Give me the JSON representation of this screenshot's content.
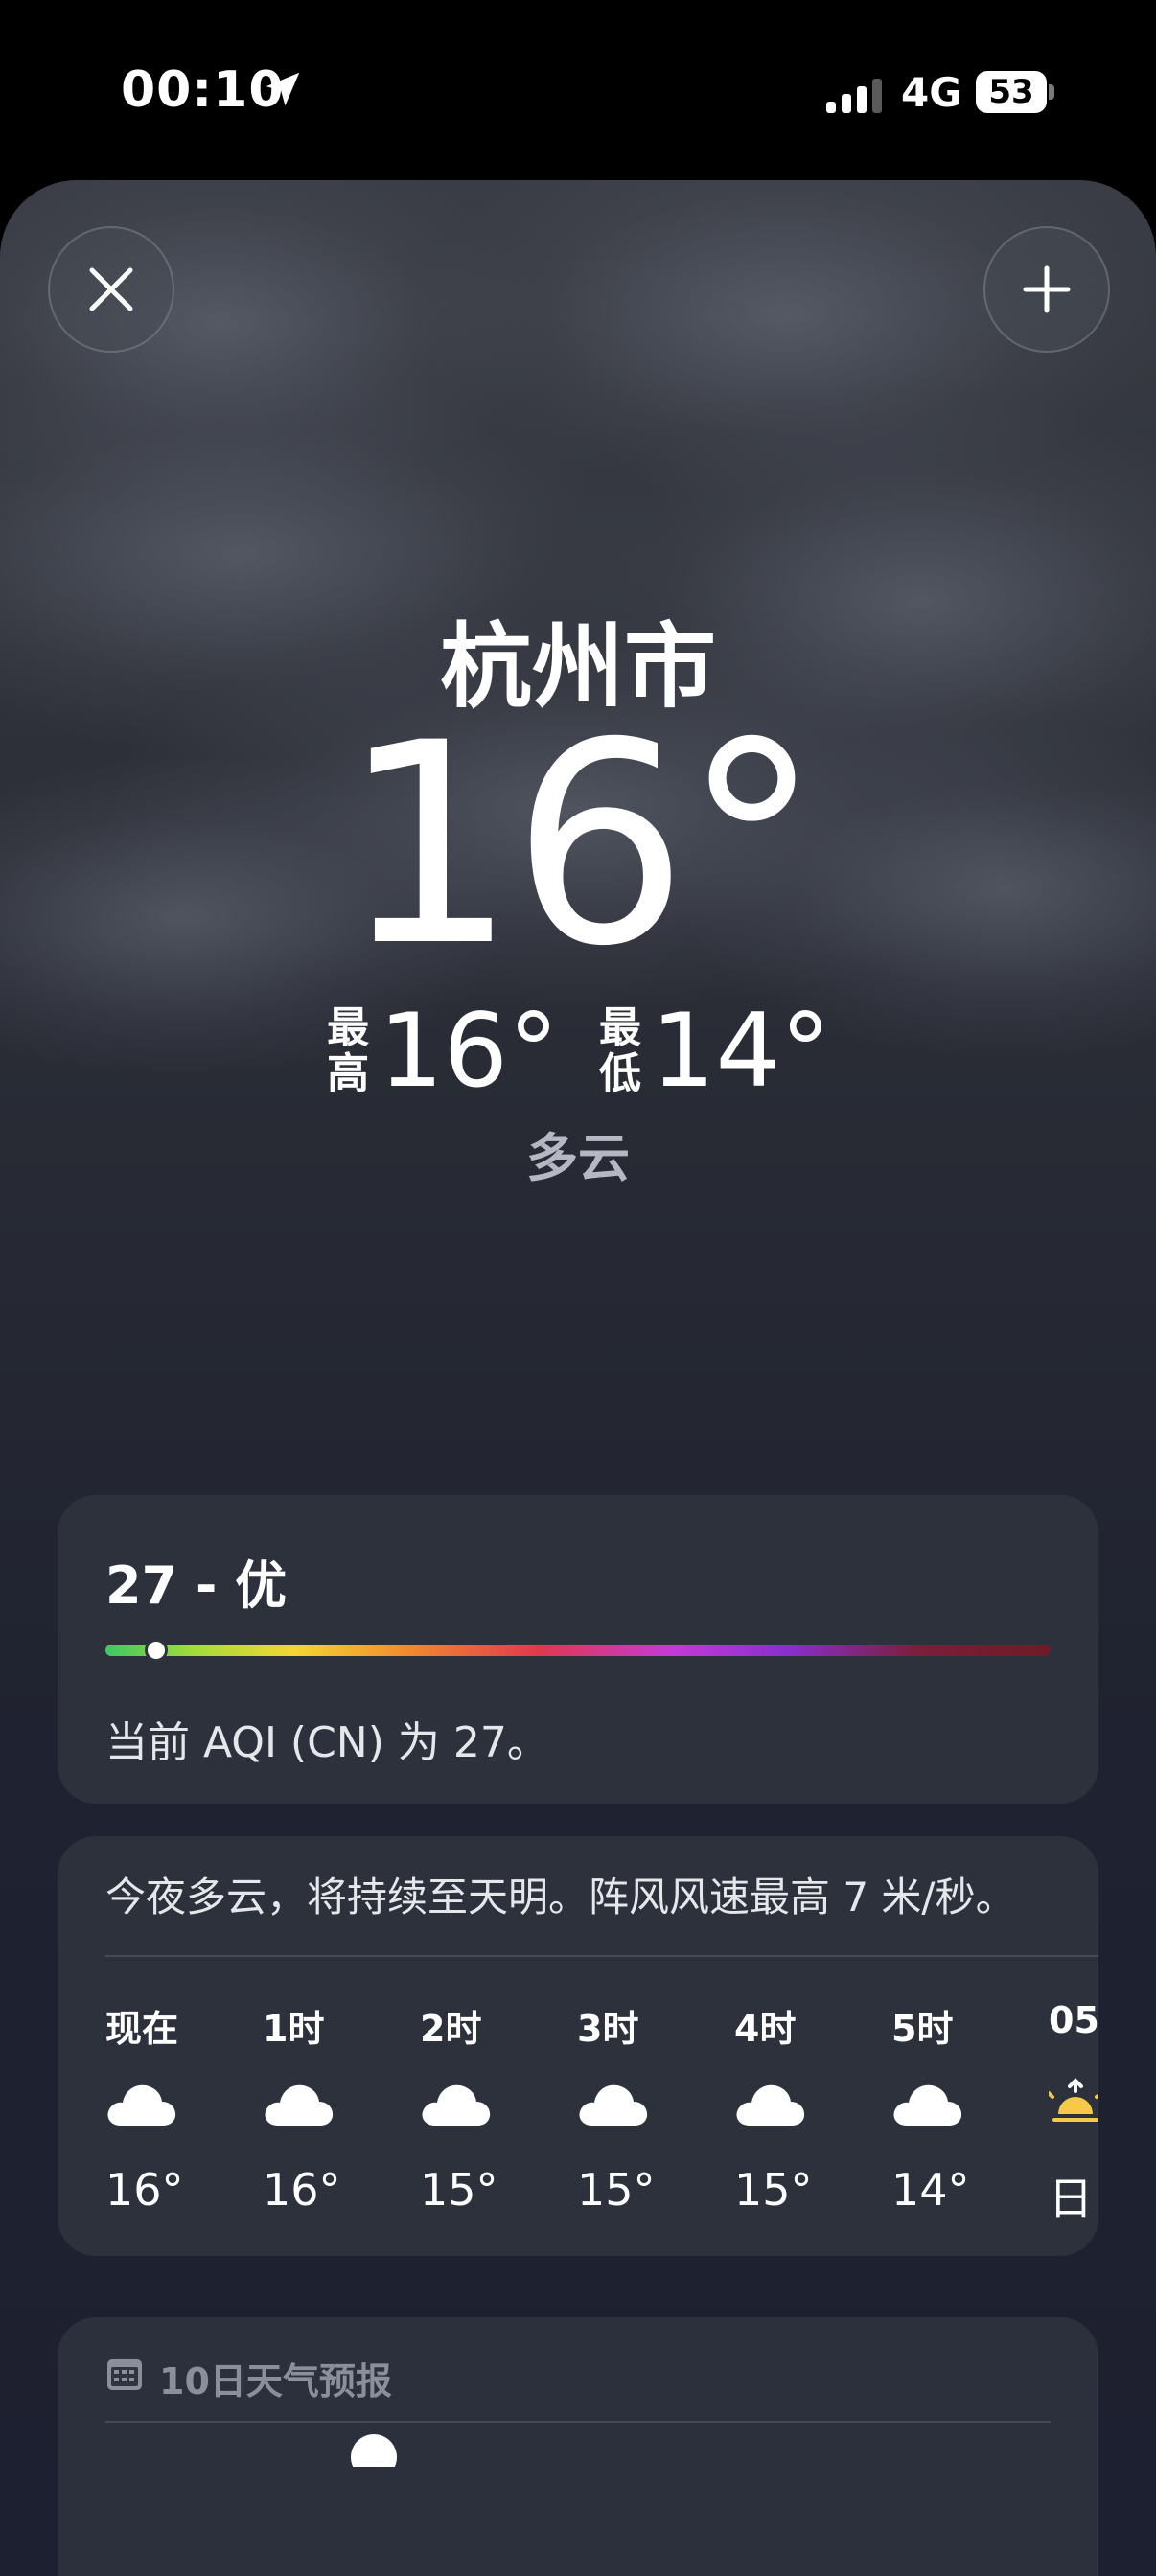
{
  "status_bar": {
    "time": "00:10",
    "network": "4G",
    "battery": "53"
  },
  "location": {
    "city": "杭州市",
    "temperature": "16°",
    "high_label": "最高",
    "high": "16°",
    "low_label": "最低",
    "low": "14°",
    "condition": "多云"
  },
  "aqi": {
    "title": "27 - 优",
    "value": 27,
    "description": "当前 AQI (CN) 为 27。"
  },
  "hourly": {
    "summary": "今夜多云，将持续至天明。阵风风速最高 7 米/秒。",
    "items": [
      {
        "label": "现在",
        "icon": "cloud-icon",
        "temp": "16°"
      },
      {
        "label": "1时",
        "icon": "cloud-icon",
        "temp": "16°"
      },
      {
        "label": "2时",
        "icon": "cloud-icon",
        "temp": "15°"
      },
      {
        "label": "3时",
        "icon": "cloud-icon",
        "temp": "15°"
      },
      {
        "label": "4时",
        "icon": "cloud-icon",
        "temp": "15°"
      },
      {
        "label": "5时",
        "icon": "cloud-icon",
        "temp": "14°"
      },
      {
        "label": "05",
        "icon": "sunrise-icon",
        "temp": "日"
      }
    ]
  },
  "forecast": {
    "title": "10日天气预报"
  },
  "colors": {
    "background": "#262933",
    "panel": "#30343f",
    "sunrise": "#f7c948"
  }
}
